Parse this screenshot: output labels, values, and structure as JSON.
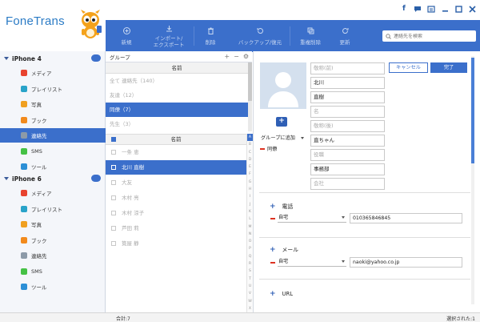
{
  "app": {
    "title": "FoneTrans"
  },
  "toolbar": {
    "new": "新規",
    "import_export": "インポート/\nエクスポート",
    "delete": "削除",
    "backup": "バックアップ/復元",
    "dedupe": "重複削除",
    "refresh": "更新",
    "search_placeholder": "連絡先を検索"
  },
  "sidebar": {
    "devices": [
      {
        "name": "iPhone 4",
        "items": [
          {
            "label": "メディア",
            "icon": "music-icon",
            "color": "#e8432f"
          },
          {
            "label": "プレイリスト",
            "icon": "playlist-icon",
            "color": "#29a3c9"
          },
          {
            "label": "写真",
            "icon": "photos-icon",
            "color": "#f0a020"
          },
          {
            "label": "ブック",
            "icon": "book-icon",
            "color": "#f28a1c"
          },
          {
            "label": "連絡先",
            "icon": "contacts-icon",
            "color": "#8c9aa8"
          },
          {
            "label": "SMS",
            "icon": "sms-icon",
            "color": "#45c145"
          },
          {
            "label": "ツール",
            "icon": "tools-icon",
            "color": "#2c8fd6"
          }
        ]
      },
      {
        "name": "iPhone 6",
        "items": [
          {
            "label": "メディア",
            "icon": "music-icon",
            "color": "#e8432f"
          },
          {
            "label": "プレイリスト",
            "icon": "playlist-icon",
            "color": "#29a3c9"
          },
          {
            "label": "写真",
            "icon": "photos-icon",
            "color": "#f0a020"
          },
          {
            "label": "ブック",
            "icon": "book-icon",
            "color": "#f28a1c"
          },
          {
            "label": "連絡先",
            "icon": "contacts-icon",
            "color": "#8c9aa8"
          },
          {
            "label": "SMS",
            "icon": "sms-icon",
            "color": "#45c145"
          },
          {
            "label": "ツール",
            "icon": "tools-icon",
            "color": "#2c8fd6"
          }
        ]
      }
    ]
  },
  "groups": {
    "header": "グループ",
    "column": "名前",
    "rows": [
      "全て 連絡先（140）",
      "友達（12）",
      "同僚（7）",
      "先生（3）"
    ]
  },
  "contacts": {
    "column": "名前",
    "rows": [
      "一条 恵",
      "北川 直樹",
      "大友",
      "木村 亮",
      "木村 涼子",
      "芦田 莉",
      "筧屋 静"
    ],
    "alphabet": [
      "A",
      "B",
      "C",
      "D",
      "E",
      "F",
      "G",
      "H",
      "I",
      "J",
      "K",
      "L",
      "M",
      "N",
      "O",
      "P",
      "Q",
      "R",
      "S",
      "T",
      "U",
      "V",
      "W",
      "X",
      "Y",
      "Z",
      "#"
    ]
  },
  "detail": {
    "cancel": "キャンセル",
    "done": "完了",
    "group_select": "グループに追加",
    "group_tag": "同僚",
    "fields": [
      {
        "value": "",
        "placeholder": "敬称(前)"
      },
      {
        "value": "北川",
        "placeholder": ""
      },
      {
        "value": "直樹",
        "placeholder": ""
      },
      {
        "value": "",
        "placeholder": "名"
      },
      {
        "value": "",
        "placeholder": "敬称(後)"
      },
      {
        "value": "直ちゃん",
        "placeholder": ""
      },
      {
        "value": "",
        "placeholder": "役職"
      },
      {
        "value": "事務部",
        "placeholder": ""
      },
      {
        "value": "",
        "placeholder": "会社"
      }
    ],
    "phone": {
      "title": "電話",
      "type": "自宅",
      "value": "010365846845"
    },
    "email": {
      "title": "メール",
      "type": "自宅",
      "value": "naoki@yahoo.co.jp"
    },
    "url": {
      "title": "URL"
    }
  },
  "status": {
    "total": "合計:7",
    "selected": "選択された:1"
  },
  "colors": {
    "accent": "#3b6fcb",
    "remove": "#dd3322"
  }
}
